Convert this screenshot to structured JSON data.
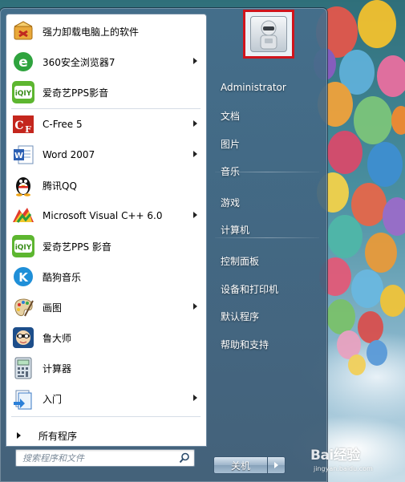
{
  "programs": [
    {
      "label": "强力卸载电脑上的软件",
      "icon": "uninstaller-box-icon",
      "has_submenu": false
    },
    {
      "label": "360安全浏览器7",
      "icon": "360-browser-icon",
      "has_submenu": true
    },
    {
      "label": "爱奇艺PPS影音",
      "icon": "iqiyi-pps-icon",
      "has_submenu": false
    },
    {
      "label": "C-Free 5",
      "icon": "cfree-icon",
      "has_submenu": true
    },
    {
      "label": "Word 2007",
      "icon": "word-icon",
      "has_submenu": true
    },
    {
      "label": "腾讯QQ",
      "icon": "qq-penguin-icon",
      "has_submenu": false
    },
    {
      "label": "Microsoft Visual C++ 6.0",
      "icon": "visual-cpp-icon",
      "has_submenu": true
    },
    {
      "label": "爱奇艺PPS 影音",
      "icon": "iqiyi-pps-icon",
      "has_submenu": false
    },
    {
      "label": "酷狗音乐",
      "icon": "kugou-icon",
      "has_submenu": false
    },
    {
      "label": "画图",
      "icon": "paint-palette-icon",
      "has_submenu": true
    },
    {
      "label": "鲁大师",
      "icon": "ludashi-icon",
      "has_submenu": false
    },
    {
      "label": "计算器",
      "icon": "calculator-icon",
      "has_submenu": false
    },
    {
      "label": "入门",
      "icon": "getting-started-icon",
      "has_submenu": true
    }
  ],
  "all_programs_label": "所有程序",
  "search": {
    "placeholder": "搜索程序和文件"
  },
  "user": {
    "avatar_icon": "robot-avatar-icon"
  },
  "right_items": [
    {
      "label": "Administrator"
    },
    {
      "label": "文档"
    },
    {
      "label": "图片"
    },
    {
      "label": "音乐"
    },
    {
      "label": "游戏"
    },
    {
      "label": "计算机"
    },
    {
      "label": "控制面板"
    },
    {
      "label": "设备和打印机"
    },
    {
      "label": "默认程序"
    },
    {
      "label": "帮助和支持"
    }
  ],
  "shutdown_label": "关机",
  "watermark": {
    "main": "Bai经验",
    "sub": "jingyan.baidu.com"
  },
  "colors": {
    "highlight_frame": "#d0141c",
    "menu_bg": "#46708c"
  }
}
